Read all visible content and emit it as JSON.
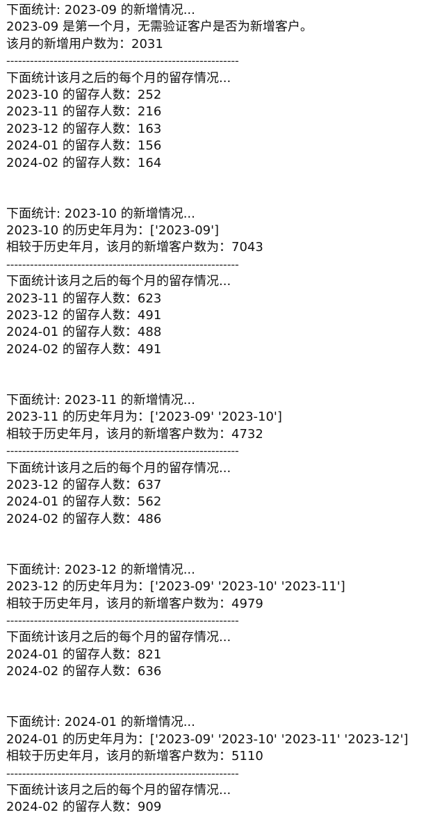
{
  "output_lines": [
    "下面统计: 2023-09 的新增情况...",
    "2023-09 是第一个月，无需验证客户是否为新增客户。",
    "该月的新增用户数为：2031",
    "-----------------------------------------------------------",
    "下面统计该月之后的每个月的留存情况...",
    "2023-10 的留存人数：252",
    "2023-11 的留存人数：216",
    "2023-12 的留存人数：163",
    "2024-01 的留存人数：156",
    "2024-02 的留存人数：164",
    "",
    "",
    "下面统计: 2023-10 的新增情况...",
    "2023-10 的历史年月为：['2023-09']",
    "相较于历史年月，该月的新增客户数为：7043",
    "-----------------------------------------------------------",
    "下面统计该月之后的每个月的留存情况...",
    "2023-11 的留存人数：623",
    "2023-12 的留存人数：491",
    "2024-01 的留存人数：488",
    "2024-02 的留存人数：491",
    "",
    "",
    "下面统计: 2023-11 的新增情况...",
    "2023-11 的历史年月为：['2023-09' '2023-10']",
    "相较于历史年月，该月的新增客户数为：4732",
    "-----------------------------------------------------------",
    "下面统计该月之后的每个月的留存情况...",
    "2023-12 的留存人数：637",
    "2024-01 的留存人数：562",
    "2024-02 的留存人数：486",
    "",
    "",
    "下面统计: 2023-12 的新增情况...",
    "2023-12 的历史年月为：['2023-09' '2023-10' '2023-11']",
    "相较于历史年月，该月的新增客户数为：4979",
    "-----------------------------------------------------------",
    "下面统计该月之后的每个月的留存情况...",
    "2024-01 的留存人数：821",
    "2024-02 的留存人数：636",
    "",
    "",
    "下面统计: 2024-01 的新增情况...",
    "2024-01 的历史年月为：['2023-09' '2023-10' '2023-11' '2023-12']",
    "相较于历史年月，该月的新增客户数为：5110",
    "-----------------------------------------------------------",
    "下面统计该月之后的每个月的留存情况...",
    "2024-02 的留存人数：909"
  ]
}
